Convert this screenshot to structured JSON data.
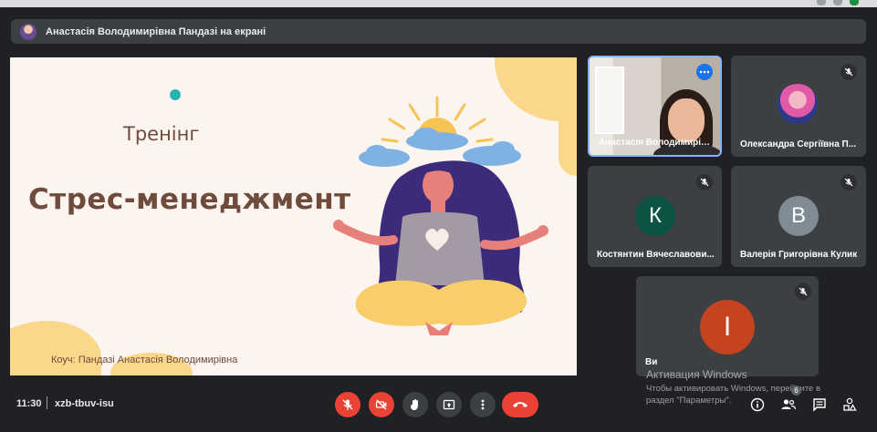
{
  "presenting_bar": {
    "text": "Анастасія Володимирівна Пандазі на екрані"
  },
  "slide": {
    "subtitle": "Тренінг",
    "title": "Стрес-менеджмент",
    "coach": "Коуч: Пандазі Анастасія Володимирівна"
  },
  "participants": [
    {
      "name": "Анастасія Володимирів...",
      "type": "video",
      "more_icon": "more-horiz-icon"
    },
    {
      "name": "Олександра Сергіївна П...",
      "type": "photo-avatar",
      "mic_icon": "mic-off-icon"
    },
    {
      "name": "Костянтин Вячеславови...",
      "type": "letter-avatar",
      "initial": "К",
      "color": "#0b5345",
      "mic_icon": "mic-off-icon"
    },
    {
      "name": "Валерія Григорівна Кулик",
      "type": "letter-avatar",
      "initial": "В",
      "color": "#7f8c96",
      "mic_icon": "mic-off-icon"
    },
    {
      "name": "Ви",
      "type": "letter-avatar",
      "initial": "I",
      "color": "#c5431f",
      "mic_icon": "mic-off-icon"
    }
  ],
  "watermark": {
    "title": "Активация Windows",
    "line1": "Чтобы активировать Windows, перейдите в",
    "line2": "раздел \"Параметры\"."
  },
  "bottom_bar": {
    "time": "11:30",
    "meeting_code": "xzb-tbuv-isu",
    "controls": [
      "mic-off-icon",
      "camera-off-icon",
      "raise-hand-icon",
      "present-screen-icon",
      "more-vert-icon",
      "end-call-icon"
    ],
    "side_icons": [
      "info-icon",
      "people-icon",
      "chat-icon",
      "activities-icon"
    ],
    "people_count": "6"
  },
  "colors": {
    "background": "#202124",
    "tile": "#3c4043",
    "danger": "#ea4335",
    "accent_blue": "#8ab4f8"
  }
}
